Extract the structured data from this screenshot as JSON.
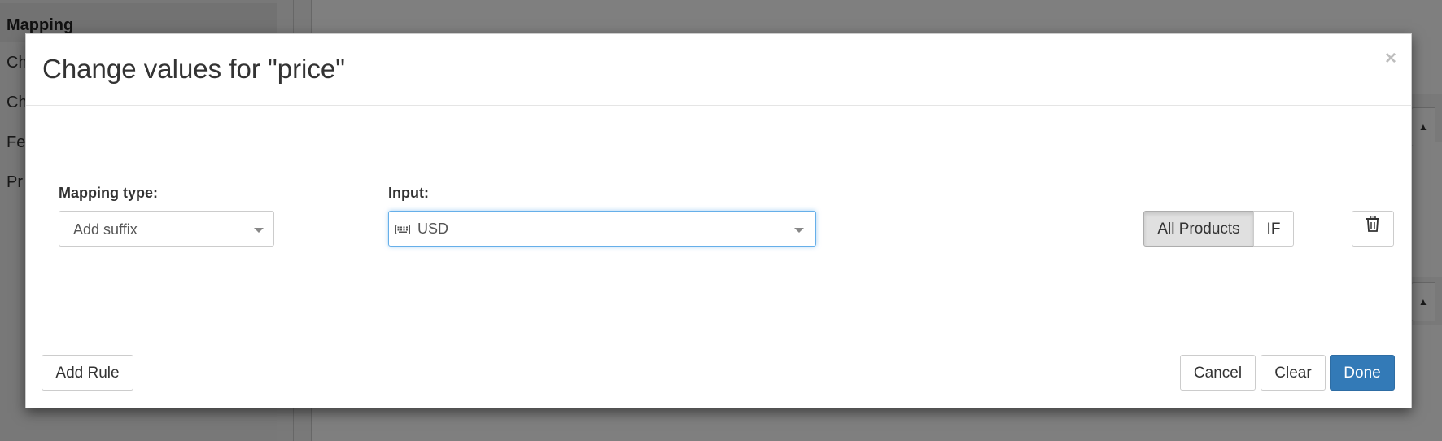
{
  "background": {
    "sidebar_header": "Mapping",
    "sidebar_items": [
      "Ch",
      "Ch",
      "Fe",
      "Pr"
    ]
  },
  "modal": {
    "title": "Change values for \"price\"",
    "close_symbol": "×",
    "mapping_type_label": "Mapping type:",
    "mapping_type_value": "Add suffix",
    "input_label": "Input:",
    "input_value": "USD",
    "scope_all_products": "All Products",
    "scope_if": "IF",
    "footer": {
      "add_rule": "Add Rule",
      "cancel": "Cancel",
      "clear": "Clear",
      "done": "Done"
    }
  },
  "colors": {
    "primary": "#337ab7",
    "focus": "#66afe9",
    "overlay": "rgba(0,0,0,0.5)"
  },
  "icons": {
    "input_prefix": "keyboard-icon",
    "delete": "trash-icon",
    "dropdown": "caret-down-icon"
  }
}
